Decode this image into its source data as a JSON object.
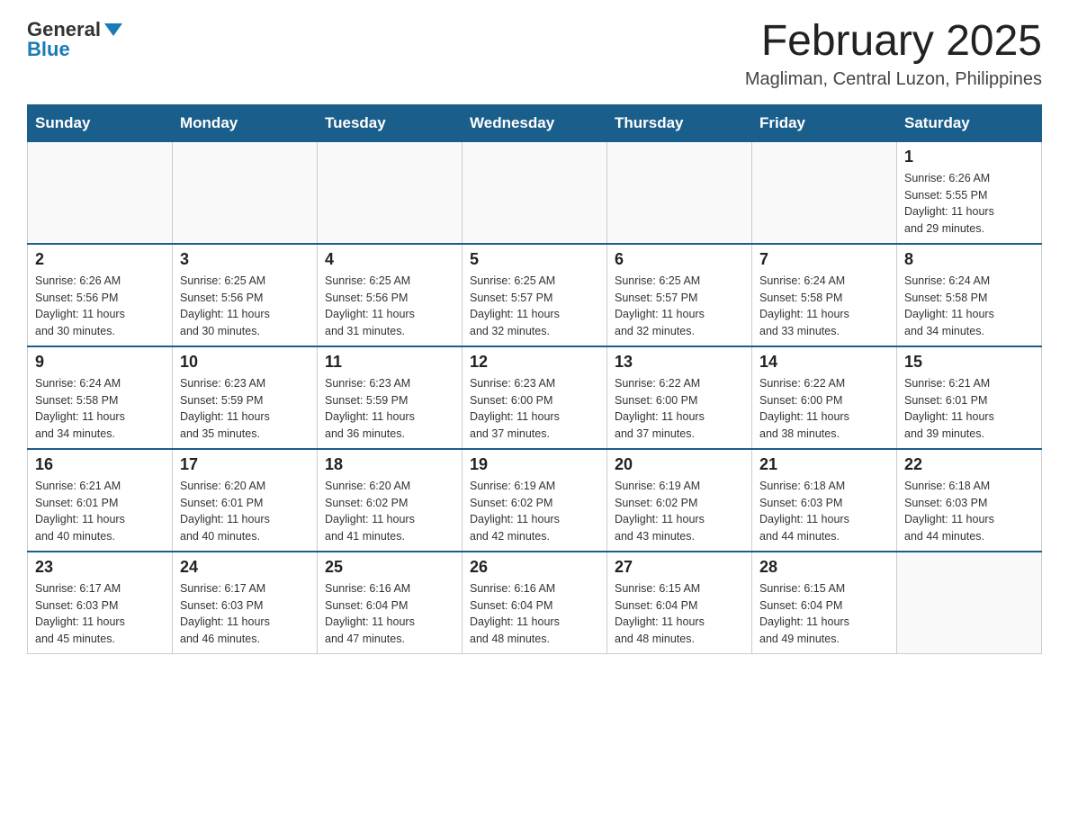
{
  "header": {
    "logo_general": "General",
    "logo_blue": "Blue",
    "month_title": "February 2025",
    "location": "Magliman, Central Luzon, Philippines"
  },
  "weekdays": [
    "Sunday",
    "Monday",
    "Tuesday",
    "Wednesday",
    "Thursday",
    "Friday",
    "Saturday"
  ],
  "weeks": [
    [
      {
        "day": "",
        "info": ""
      },
      {
        "day": "",
        "info": ""
      },
      {
        "day": "",
        "info": ""
      },
      {
        "day": "",
        "info": ""
      },
      {
        "day": "",
        "info": ""
      },
      {
        "day": "",
        "info": ""
      },
      {
        "day": "1",
        "info": "Sunrise: 6:26 AM\nSunset: 5:55 PM\nDaylight: 11 hours\nand 29 minutes."
      }
    ],
    [
      {
        "day": "2",
        "info": "Sunrise: 6:26 AM\nSunset: 5:56 PM\nDaylight: 11 hours\nand 30 minutes."
      },
      {
        "day": "3",
        "info": "Sunrise: 6:25 AM\nSunset: 5:56 PM\nDaylight: 11 hours\nand 30 minutes."
      },
      {
        "day": "4",
        "info": "Sunrise: 6:25 AM\nSunset: 5:56 PM\nDaylight: 11 hours\nand 31 minutes."
      },
      {
        "day": "5",
        "info": "Sunrise: 6:25 AM\nSunset: 5:57 PM\nDaylight: 11 hours\nand 32 minutes."
      },
      {
        "day": "6",
        "info": "Sunrise: 6:25 AM\nSunset: 5:57 PM\nDaylight: 11 hours\nand 32 minutes."
      },
      {
        "day": "7",
        "info": "Sunrise: 6:24 AM\nSunset: 5:58 PM\nDaylight: 11 hours\nand 33 minutes."
      },
      {
        "day": "8",
        "info": "Sunrise: 6:24 AM\nSunset: 5:58 PM\nDaylight: 11 hours\nand 34 minutes."
      }
    ],
    [
      {
        "day": "9",
        "info": "Sunrise: 6:24 AM\nSunset: 5:58 PM\nDaylight: 11 hours\nand 34 minutes."
      },
      {
        "day": "10",
        "info": "Sunrise: 6:23 AM\nSunset: 5:59 PM\nDaylight: 11 hours\nand 35 minutes."
      },
      {
        "day": "11",
        "info": "Sunrise: 6:23 AM\nSunset: 5:59 PM\nDaylight: 11 hours\nand 36 minutes."
      },
      {
        "day": "12",
        "info": "Sunrise: 6:23 AM\nSunset: 6:00 PM\nDaylight: 11 hours\nand 37 minutes."
      },
      {
        "day": "13",
        "info": "Sunrise: 6:22 AM\nSunset: 6:00 PM\nDaylight: 11 hours\nand 37 minutes."
      },
      {
        "day": "14",
        "info": "Sunrise: 6:22 AM\nSunset: 6:00 PM\nDaylight: 11 hours\nand 38 minutes."
      },
      {
        "day": "15",
        "info": "Sunrise: 6:21 AM\nSunset: 6:01 PM\nDaylight: 11 hours\nand 39 minutes."
      }
    ],
    [
      {
        "day": "16",
        "info": "Sunrise: 6:21 AM\nSunset: 6:01 PM\nDaylight: 11 hours\nand 40 minutes."
      },
      {
        "day": "17",
        "info": "Sunrise: 6:20 AM\nSunset: 6:01 PM\nDaylight: 11 hours\nand 40 minutes."
      },
      {
        "day": "18",
        "info": "Sunrise: 6:20 AM\nSunset: 6:02 PM\nDaylight: 11 hours\nand 41 minutes."
      },
      {
        "day": "19",
        "info": "Sunrise: 6:19 AM\nSunset: 6:02 PM\nDaylight: 11 hours\nand 42 minutes."
      },
      {
        "day": "20",
        "info": "Sunrise: 6:19 AM\nSunset: 6:02 PM\nDaylight: 11 hours\nand 43 minutes."
      },
      {
        "day": "21",
        "info": "Sunrise: 6:18 AM\nSunset: 6:03 PM\nDaylight: 11 hours\nand 44 minutes."
      },
      {
        "day": "22",
        "info": "Sunrise: 6:18 AM\nSunset: 6:03 PM\nDaylight: 11 hours\nand 44 minutes."
      }
    ],
    [
      {
        "day": "23",
        "info": "Sunrise: 6:17 AM\nSunset: 6:03 PM\nDaylight: 11 hours\nand 45 minutes."
      },
      {
        "day": "24",
        "info": "Sunrise: 6:17 AM\nSunset: 6:03 PM\nDaylight: 11 hours\nand 46 minutes."
      },
      {
        "day": "25",
        "info": "Sunrise: 6:16 AM\nSunset: 6:04 PM\nDaylight: 11 hours\nand 47 minutes."
      },
      {
        "day": "26",
        "info": "Sunrise: 6:16 AM\nSunset: 6:04 PM\nDaylight: 11 hours\nand 48 minutes."
      },
      {
        "day": "27",
        "info": "Sunrise: 6:15 AM\nSunset: 6:04 PM\nDaylight: 11 hours\nand 48 minutes."
      },
      {
        "day": "28",
        "info": "Sunrise: 6:15 AM\nSunset: 6:04 PM\nDaylight: 11 hours\nand 49 minutes."
      },
      {
        "day": "",
        "info": ""
      }
    ]
  ]
}
